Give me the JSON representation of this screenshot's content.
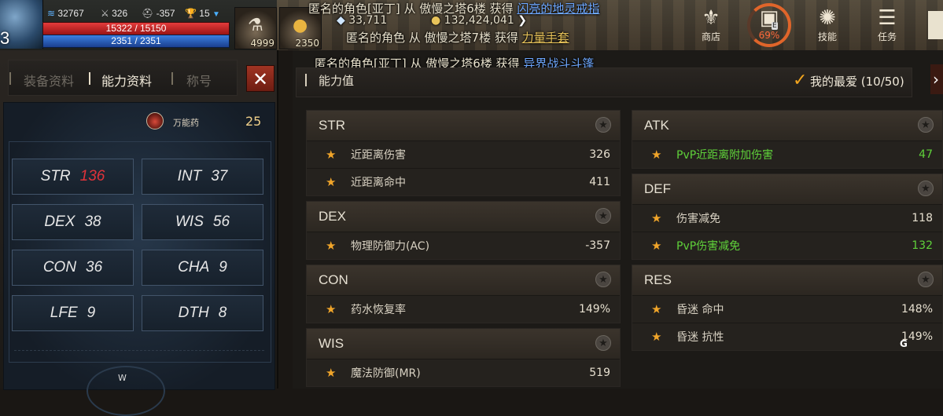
{
  "hud": {
    "level": "3",
    "stats": [
      {
        "icon": "mana-wave-icon",
        "value": "32767"
      },
      {
        "icon": "sword-icon",
        "value": "326"
      },
      {
        "icon": "helmet-icon",
        "value": "-357"
      },
      {
        "icon": "trophy-icon",
        "value": "15"
      }
    ],
    "hp": "15322 / 15150",
    "mp": "2351 / 2351",
    "hp_fill": 1.0,
    "mp_fill": 1.0,
    "potions": [
      {
        "icon": "potion-bottle-icon",
        "count": "4999"
      },
      {
        "icon": "gold-potion-icon",
        "count": "2350"
      }
    ],
    "currency_diamond": "33,711",
    "currency_gold": "132,424,041",
    "notices": [
      {
        "text": "匿名的角色[亚丁] 从 傲慢之塔6楼 获得 ",
        "item": "闪亮的地灵戒指"
      },
      {
        "text": "匿名的角色 从 傲慢之塔7楼 获得 ",
        "item": "力量手套"
      },
      {
        "text": "匿名的角色[亚丁] 从 傲慢之塔6楼 获得 ",
        "item": "异界战斗斗篷"
      }
    ],
    "menu": [
      {
        "label": "商店",
        "icon": "shop-bag-icon"
      },
      {
        "label": "69%",
        "icon": "backpack-icon"
      },
      {
        "label": "技能",
        "icon": "skill-swirl-icon"
      },
      {
        "label": "任务",
        "icon": "quest-scroll-icon"
      }
    ],
    "backpack_badge": "E"
  },
  "left": {
    "tabs": [
      "装备资料",
      "能力资料",
      "称号"
    ],
    "active_tab": "能力资料",
    "potion_name": "万能药",
    "potion_count": "25",
    "stats": [
      {
        "label": "STR",
        "value": "136",
        "highlight": true
      },
      {
        "label": "INT",
        "value": "37"
      },
      {
        "label": "DEX",
        "value": "38"
      },
      {
        "label": "WIS",
        "value": "56"
      },
      {
        "label": "CON",
        "value": "36"
      },
      {
        "label": "CHA",
        "value": "9"
      },
      {
        "label": "LFE",
        "value": "9"
      },
      {
        "label": "DTH",
        "value": "8"
      }
    ],
    "compass_label": "W"
  },
  "right": {
    "title": "能力值",
    "favorite_label": "我的最爱 (10/50)",
    "left_groups": [
      {
        "title": "STR",
        "rows": [
          {
            "name": "近距离伤害",
            "value": "326"
          },
          {
            "name": "近距离命中",
            "value": "411"
          }
        ]
      },
      {
        "title": "DEX",
        "rows": [
          {
            "name": "物理防御力(AC)",
            "value": "-357"
          }
        ]
      },
      {
        "title": "CON",
        "rows": [
          {
            "name": "药水恢复率",
            "value": "149%"
          }
        ]
      },
      {
        "title": "WIS",
        "rows": [
          {
            "name": "魔法防御(MR)",
            "value": "519"
          }
        ]
      }
    ],
    "right_groups": [
      {
        "title": "ATK",
        "rows": [
          {
            "name": "PvP近距离附加伤害",
            "value": "47",
            "pvp": true
          }
        ]
      },
      {
        "title": "DEF",
        "rows": [
          {
            "name": "伤害减免",
            "value": "118"
          },
          {
            "name": "PvP伤害减免",
            "value": "132",
            "pvp": true
          }
        ]
      },
      {
        "title": "RES",
        "rows": [
          {
            "name": "昏迷 命中",
            "value": "148%"
          },
          {
            "name": "昏迷 抗性",
            "value": "149%"
          }
        ]
      }
    ],
    "corner_mark": "G"
  }
}
